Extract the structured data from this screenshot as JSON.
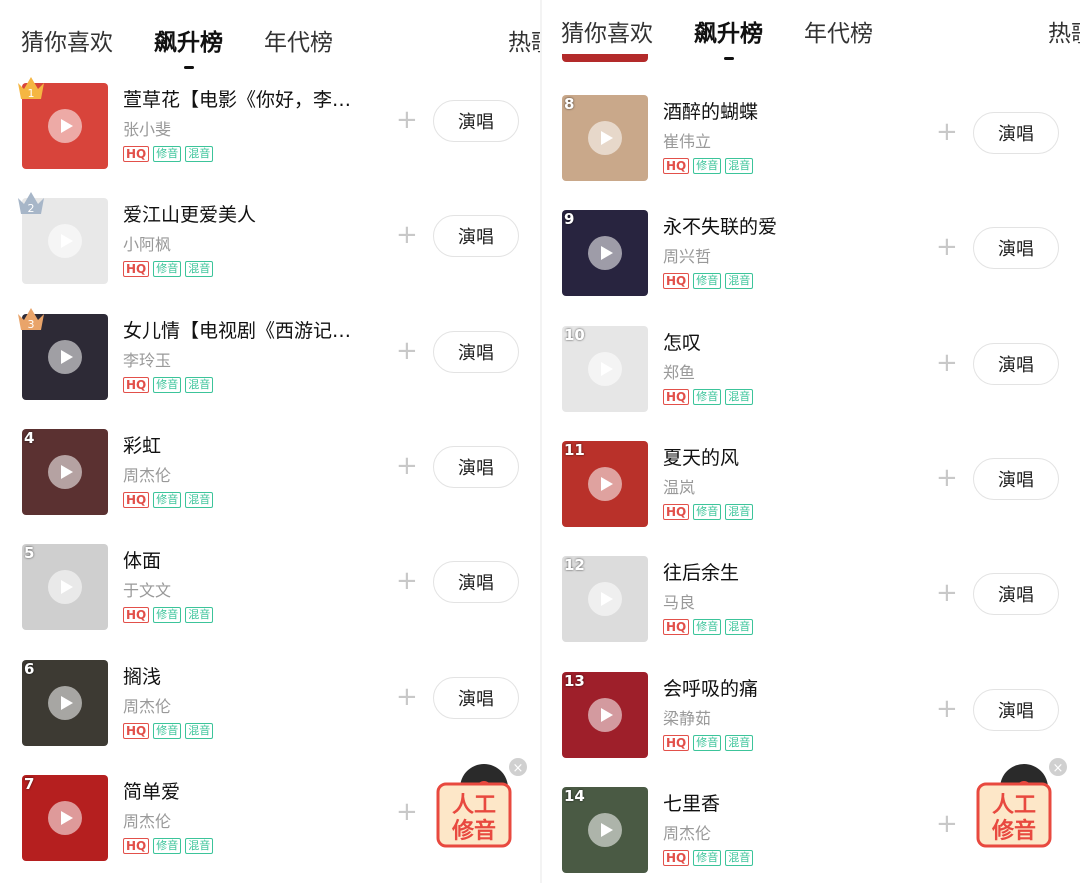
{
  "tabs": {
    "guess": "猜你喜欢",
    "rising": "飙升榜",
    "decade": "年代榜",
    "hot_left": "热歌",
    "hot_right": "热歌"
  },
  "tag_labels": {
    "hq": "HQ",
    "edit": "修音",
    "mix": "混音"
  },
  "sing_label": "演唱",
  "add_label": "+",
  "badge": {
    "line1": "人工",
    "line2": "修音",
    "close": "×"
  },
  "colors": {
    "hq": "#e2504a",
    "tag_green": "#3cc49a",
    "crown_gold": "#f5b642",
    "crown_silver": "#a7b6c8",
    "crown_bronze": "#e9a46a",
    "badge_red": "#e8493f"
  },
  "left_songs": [
    {
      "rank": "1",
      "title": "萱草花【电影《你好，李…",
      "artist": "张小斐",
      "cover": "#d8443b"
    },
    {
      "rank": "2",
      "title": "爱江山更爱美人",
      "artist": "小阿枫",
      "cover": "#e8e8e8"
    },
    {
      "rank": "3",
      "title": "女儿情【电视剧《西游记…",
      "artist": "李玲玉",
      "cover": "#2d2a36"
    },
    {
      "rank": "4",
      "title": "彩虹",
      "artist": "周杰伦",
      "cover": "#5b3131"
    },
    {
      "rank": "5",
      "title": "体面",
      "artist": "于文文",
      "cover": "#cfcfcf"
    },
    {
      "rank": "6",
      "title": "搁浅",
      "artist": "周杰伦",
      "cover": "#3d3a33"
    },
    {
      "rank": "7",
      "title": "简单爱",
      "artist": "周杰伦",
      "cover": "#b51f1f"
    }
  ],
  "right_songs": [
    {
      "rank": "8",
      "title": "酒醉的蝴蝶",
      "artist": "崔伟立",
      "cover": "#c9a88a"
    },
    {
      "rank": "9",
      "title": "永不失联的爱",
      "artist": "周兴哲",
      "cover": "#28243f"
    },
    {
      "rank": "10",
      "title": "怎叹",
      "artist": "郑鱼",
      "cover": "#e6e6e6"
    },
    {
      "rank": "11",
      "title": "夏天的风",
      "artist": "温岚",
      "cover": "#b9312a"
    },
    {
      "rank": "12",
      "title": "往后余生",
      "artist": "马良",
      "cover": "#dcdcdc"
    },
    {
      "rank": "13",
      "title": "会呼吸的痛",
      "artist": "梁静茹",
      "cover": "#9e1f2a"
    },
    {
      "rank": "14",
      "title": "七里香",
      "artist": "周杰伦",
      "cover": "#4a5a44"
    }
  ]
}
